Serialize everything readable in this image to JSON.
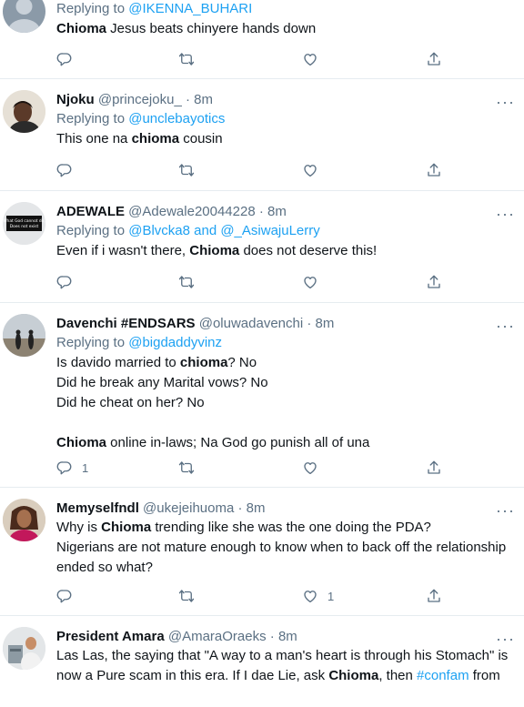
{
  "colors": {
    "link": "#1da1f2",
    "secondary": "#5b7083",
    "border": "#e6ecf0"
  },
  "more_label": "···",
  "tweets": [
    {
      "replying_prefix": "Replying to ",
      "replying_to": "@IKENNA_BUHARI",
      "text_bold": "Chioma",
      "text_rest": " Jesus beats chinyere hands down"
    },
    {
      "name": "Njoku",
      "handle": "@princejoku_",
      "time": "· 8m",
      "replying_prefix": "Replying to ",
      "replying_to": "@unclebayotics",
      "text_pre": "This one na ",
      "text_bold": "chioma",
      "text_rest": " cousin"
    },
    {
      "name": "ADEWALE",
      "handle": "@Adewale20044228",
      "time": "· 8m",
      "avatar_text": "What God cannot do, Does not exist",
      "replying_prefix": "Replying to ",
      "replying_to": "@Blvcka8 and @_AsiwajuLerry",
      "text_pre": "Even if i wasn't there, ",
      "text_bold": "Chioma",
      "text_rest": " does not deserve this!"
    },
    {
      "name": "Davenchi #ENDSARS",
      "handle": "@oluwadavenchi",
      "time": "· 8m",
      "replying_prefix": "Replying to ",
      "replying_to": "@bigdaddyvinz",
      "line1_pre": "Is davido married to ",
      "line1_bold": "chioma",
      "line1_rest": "? No",
      "line2": "Did he break any Marital vows? No",
      "line3": "Did he cheat on her? No",
      "line4_bold": "Chioma",
      "line4_rest": " online in-laws; Na God go punish all of una",
      "reply_count": "1"
    },
    {
      "name": "Memyselfndl",
      "handle": "@ukejeihuoma",
      "time": "· 8m",
      "line1_pre": "Why is ",
      "line1_bold": "Chioma",
      "line1_rest": " trending like she was the one doing the PDA?",
      "line2": "Nigerians are not mature enough to know when to back off the relationship",
      "line3": "ended so what?",
      "like_count": "1"
    },
    {
      "name": "President Amara",
      "handle": "@AmaraOraeks",
      "time": "· 8m",
      "line1": "Las Las, the saying that \"A way to a man's heart is through his Stomach\" is",
      "line2_pre": "now a Pure scam in this era. If I dae Lie, ask ",
      "line2_bold": "Chioma",
      "line2_mid": ", then ",
      "line2_hashtag": "#confam",
      "line2_rest": " from"
    }
  ]
}
